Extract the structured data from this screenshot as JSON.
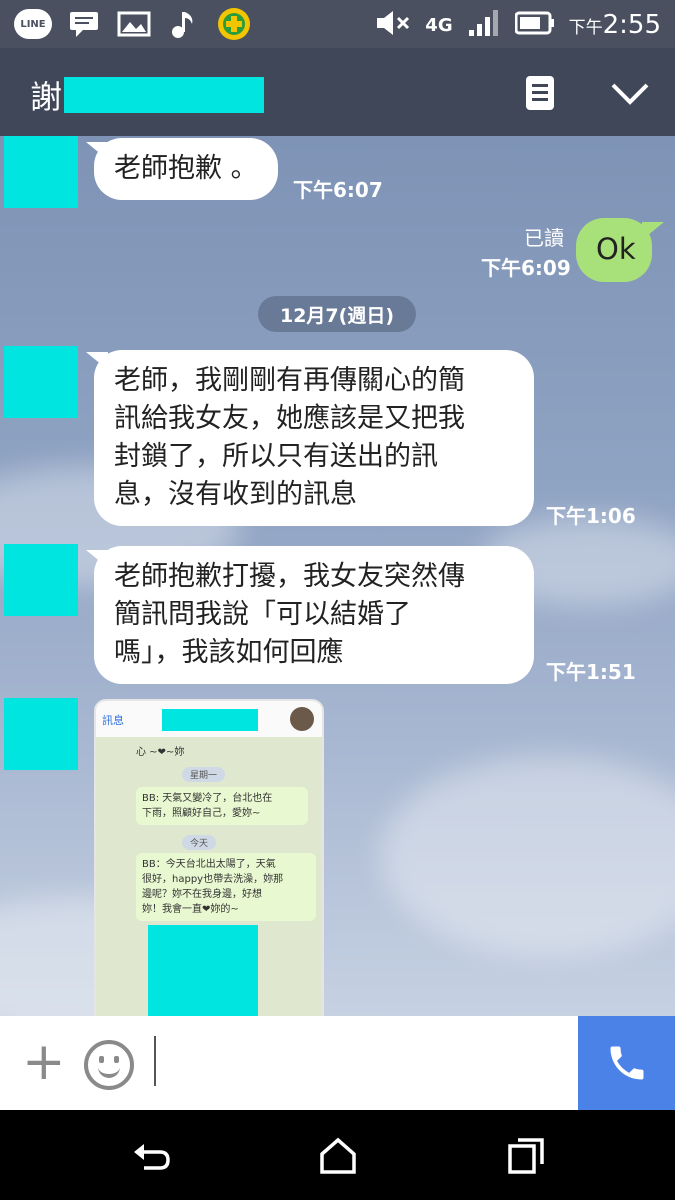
{
  "status_bar": {
    "time_prefix": "下午",
    "time": "2:55",
    "network": "4G",
    "line_logo": "LINE"
  },
  "header": {
    "contact_name_visible": "謝"
  },
  "chat": {
    "date_divider": "12月7(週日)",
    "messages": [
      {
        "id": "m1",
        "direction": "incoming",
        "text": "老師抱歉 。",
        "time": "下午6:07"
      },
      {
        "id": "m2",
        "direction": "outgoing",
        "text": "Ok",
        "read": "已讀",
        "time": "下午6:09"
      },
      {
        "id": "m3",
        "direction": "incoming",
        "text": "老師，我剛剛有再傳關心的簡\n訊給我女友，她應該是又把我\n封鎖了，所以只有送出的訊\n息，沒有收到的訊息",
        "time": "下午1:06"
      },
      {
        "id": "m4",
        "direction": "incoming",
        "text": "老師抱歉打擾，我女友突然傳\n簡訊問我說「可以結婚了\n嗎」，我該如何回應",
        "time": "下午1:51"
      }
    ],
    "image_message": {
      "back_label": "訊息",
      "line1": "心 ~❤~妳",
      "tag1": "星期一",
      "bubble1": "BB: 天氣又變冷了，台北也在\n下雨，照顧好自己，愛妳~",
      "tag2": "今天",
      "bubble2": "BB：今天台北出太陽了，天氣\n很好，happy也帶去洗澡，妳那\n邊呢？妳不在我身邊，好想\n妳！我會一直❤妳的~"
    }
  },
  "colors": {
    "header_bg": "#3f4758",
    "outgoing_bubble": "#a8e07a",
    "call_button": "#4b82e8",
    "redaction": "#00e5e0"
  },
  "icons": {
    "header": [
      "notes-icon",
      "chevron-down-icon"
    ],
    "input": [
      "plus-icon",
      "emoji-icon",
      "phone-icon"
    ],
    "nav": [
      "back-icon",
      "home-icon",
      "recent-apps-icon"
    ]
  }
}
